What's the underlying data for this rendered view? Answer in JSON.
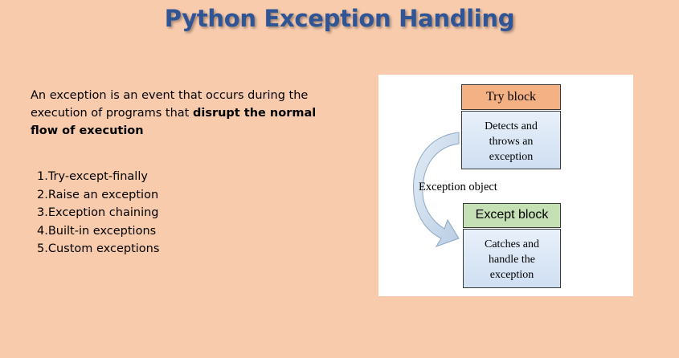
{
  "title": "Python Exception Handling",
  "intro": {
    "text_plain": "An exception is an event that occurs during the execution of programs that ",
    "text_bold": "disrupt the normal flow of execution"
  },
  "list_items": [
    "1.Try-except-finally",
    "2.Raise an exception",
    "3.Exception chaining",
    "4.Built-in exceptions",
    "5.Custom exceptions"
  ],
  "diagram": {
    "try_label": "Try  block",
    "try_desc": [
      "Detects and",
      "throws an",
      "exception"
    ],
    "arrow_label": "Exception object",
    "except_label": "Except block",
    "except_desc": [
      "Catches and",
      "handle the",
      "exception"
    ]
  },
  "colors": {
    "background": "#f8cbad",
    "title": "#2f5597",
    "try_header": "#f4b183",
    "except_header": "#c5e0b4",
    "desc_box": "#dbe7f5",
    "arrow": "#c9d9ea"
  }
}
